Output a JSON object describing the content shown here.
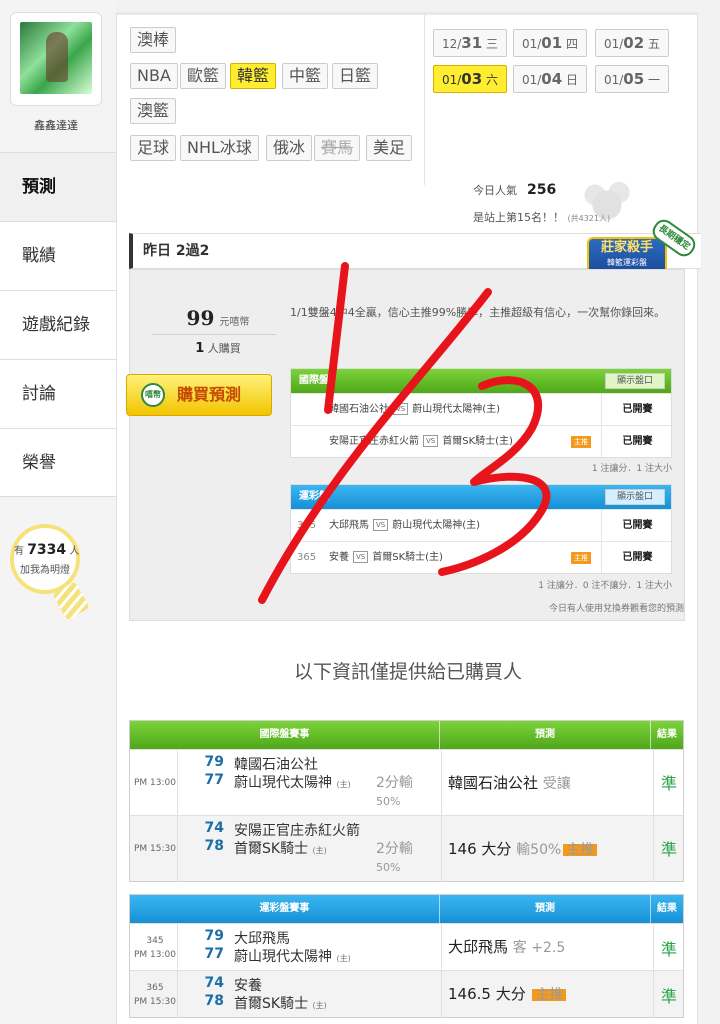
{
  "user": {
    "name": "鑫鑫達達"
  },
  "nav": [
    "預測",
    "戰績",
    "遊戲紀錄",
    "討論",
    "榮譽"
  ],
  "bulb": {
    "prefix": "有",
    "count": "7334",
    "suffix": "人",
    "line2": "加我為明燈"
  },
  "sports": [
    {
      "label": "澳棒",
      "state": "normal"
    },
    {
      "label": "NBA",
      "state": "normal"
    },
    {
      "label": "歐籃",
      "state": "normal"
    },
    {
      "label": "韓籃",
      "state": "selected"
    },
    {
      "label": "中籃",
      "state": "normal"
    },
    {
      "label": "日籃",
      "state": "normal"
    },
    {
      "label": "澳籃",
      "state": "normal"
    },
    {
      "label": "足球",
      "state": "normal"
    },
    {
      "label": "NHL冰球",
      "state": "normal"
    },
    {
      "label": "俄冰",
      "state": "normal"
    },
    {
      "label": "賽馬",
      "state": "disabled"
    },
    {
      "label": "美足",
      "state": "normal"
    }
  ],
  "dates": [
    {
      "md": "12/",
      "d": "31",
      "wd": "三",
      "sel": false
    },
    {
      "md": "01/",
      "d": "01",
      "wd": "四",
      "sel": false
    },
    {
      "md": "01/",
      "d": "02",
      "wd": "五",
      "sel": false
    },
    {
      "md": "01/",
      "d": "03",
      "wd": "六",
      "sel": true
    },
    {
      "md": "01/",
      "d": "04",
      "wd": "日",
      "sel": false
    },
    {
      "md": "01/",
      "d": "05",
      "wd": "一",
      "sel": false
    }
  ],
  "popularity": {
    "label": "今日人氣",
    "value": "256",
    "rank": "是站上第15名！！",
    "total": "(共4321人)"
  },
  "yesterday": "昨日 2過2",
  "badge": {
    "title": "莊家殺手",
    "sub": "韓籃運彩盤",
    "ribbon": "長期穩定"
  },
  "price": {
    "amount": "99",
    "unit": "元嘻幣",
    "buyers": "1",
    "buyers_unit": "人購買"
  },
  "buy_button": {
    "icon": "嘻幣",
    "label": "購買預測"
  },
  "description": "1/1雙盤4中4全贏，信心主推99%勝率，主推超級有信心，一次幫你錄回來。",
  "mini_intl": {
    "title": "國際盤",
    "button": "顯示盤口",
    "rows": [
      {
        "no": "",
        "home": "韓國石油公社",
        "away": "蔚山現代太陽神(主)",
        "tag": "",
        "result": "已開賽"
      },
      {
        "no": "",
        "home": "安陽正官庄赤紅火箭",
        "away": "首爾SK騎士(主)",
        "tag": "主推",
        "result": "已開賽"
      }
    ],
    "note": "1 注讓分．1 注大小"
  },
  "mini_lottery": {
    "title": "運彩盤",
    "button": "顯示盤口",
    "rows": [
      {
        "no": "345",
        "home": "大邱飛馬",
        "away": "蔚山現代太陽神(主)",
        "tag": "",
        "result": "已開賽"
      },
      {
        "no": "365",
        "home": "安養",
        "away": "首爾SK騎士(主)",
        "tag": "主推",
        "result": "已開賽"
      }
    ],
    "note": "1 注讓分．0 注不讓分．1 注大小",
    "note2": "今日有人使用兌換券觀看您的預測"
  },
  "notice": "以下資訊僅提供給已購買人",
  "table_intl": {
    "headers": [
      "國際盤賽事",
      "預測",
      "結果"
    ],
    "rows": [
      {
        "no": "",
        "time": "PM 13:00",
        "s1": "79",
        "t1": "韓國石油公社",
        "s2": "77",
        "t2": "蔚山現代太陽神",
        "home": "(主)",
        "line1": "2分輸",
        "line2": "50%",
        "pred": "韓國石油公社",
        "pred_sub": "受讓",
        "tag": "",
        "result": "準"
      },
      {
        "no": "",
        "time": "PM 15:30",
        "s1": "74",
        "t1": "安陽正官庄赤紅火箭",
        "s2": "78",
        "t2": "首爾SK騎士",
        "home": "(主)",
        "line1": "2分輸",
        "line2": "50%",
        "pred": "146 大分",
        "pred_sub": "輸50%",
        "tag": "主推",
        "result": "準"
      }
    ]
  },
  "table_lottery": {
    "headers": [
      "運彩盤賽事",
      "預測",
      "結果"
    ],
    "rows": [
      {
        "no": "345",
        "time": "PM 13:00",
        "s1": "79",
        "t1": "大邱飛馬",
        "s2": "77",
        "t2": "蔚山現代太陽神",
        "home": "(主)",
        "pred": "大邱飛馬",
        "pred_sub": "客 +2.5",
        "tag": "",
        "result": "準"
      },
      {
        "no": "365",
        "time": "PM 15:30",
        "s1": "74",
        "t1": "安養",
        "s2": "78",
        "t2": "首爾SK騎士",
        "home": "(主)",
        "pred": "146.5 大分",
        "pred_sub": "",
        "tag": "主推",
        "result": "準"
      }
    ]
  },
  "handwriting": {
    "text": "1/3",
    "color": "#e8141c"
  }
}
